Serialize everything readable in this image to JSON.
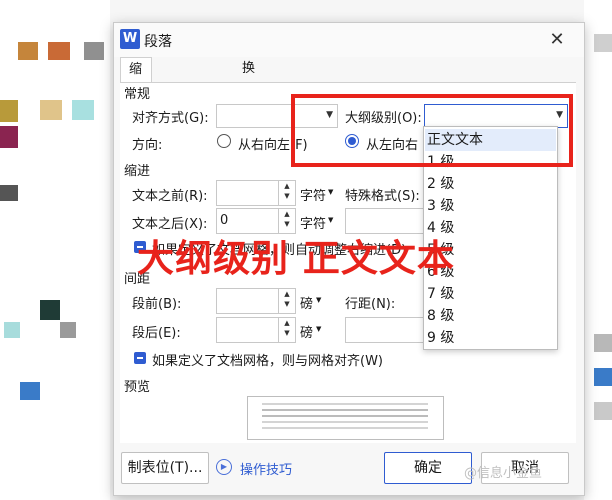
{
  "app": {
    "icon_letter": "W",
    "title": "段落"
  },
  "tabs": [
    {
      "label": "缩进和间距(I)"
    },
    {
      "label": "换行和分页(P)"
    }
  ],
  "general": {
    "section_label": "常规",
    "alignment_label": "对齐方式(G):",
    "outline_label": "大纲级别(O):",
    "direction_label": "方向:",
    "rtl_label": "从右向左(F)",
    "ltr_label": "从左向右"
  },
  "indent": {
    "section_label": "缩进",
    "before_label": "文本之前(R):",
    "after_label": "文本之后(X):",
    "after_value": "0",
    "unit": "字符",
    "special_label": "特殊格式(S):",
    "grid_check_label": "如果定义了文档网格，则自动调整右缩进(D)"
  },
  "spacing": {
    "section_label": "间距",
    "before_label": "段前(B):",
    "after_label": "段后(E):",
    "unit": "磅",
    "line_label": "行距(N):",
    "grid_check_label": "如果定义了文档网格，则与网格对齐(W)"
  },
  "preview": {
    "section_label": "预览"
  },
  "footer": {
    "tabs_button": "制表位(T)...",
    "tips_label": "操作技巧",
    "ok_button": "确定",
    "cancel_button": "取消"
  },
  "outline_dropdown": {
    "items": [
      "正文文本",
      "1 级",
      "2 级",
      "3 级",
      "4 级",
      "5 级",
      "6 级",
      "7 级",
      "8 级",
      "9 级"
    ],
    "selected": "正文文本"
  },
  "annotation": {
    "text": "大纲级别 正文文本",
    "color": "#e8231b"
  },
  "watermark": {
    "text": "@信息小金鱼"
  },
  "colors": {
    "accent": "#2f5cd1",
    "highlight": "#e8231b"
  }
}
